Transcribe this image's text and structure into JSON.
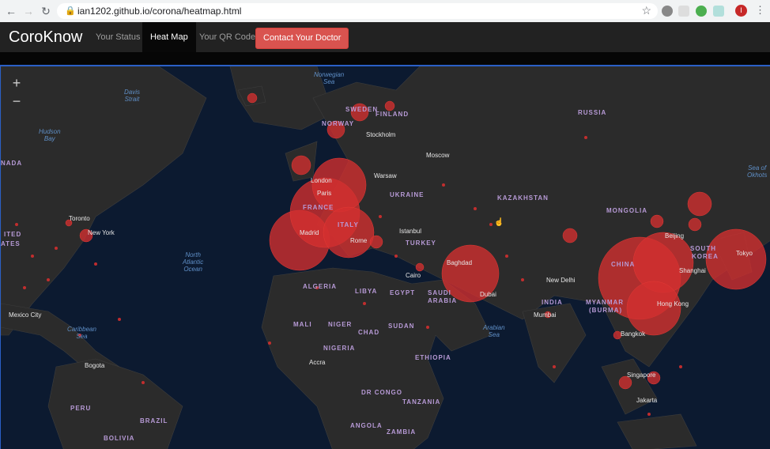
{
  "browser": {
    "url": "ian1202.github.io/corona/heatmap.html",
    "profile_initial": "I"
  },
  "navbar": {
    "brand": "CoroKnow",
    "items": [
      "Your Status",
      "Heat Map",
      "Your QR Code"
    ],
    "cta": "Contact Your Doctor"
  },
  "map": {
    "zoom_in": "+",
    "zoom_out": "−",
    "countries": [
      "RUSSIA",
      "KAZAKHSTAN",
      "MONGOLIA",
      "CHINA",
      "INDIA",
      "UKRAINE",
      "TURKEY",
      "ALGERIA",
      "LIBYA",
      "EGYPT",
      "SAUDI ARABIA",
      "MALI",
      "NIGER",
      "CHAD",
      "SUDAN",
      "NIGERIA",
      "ETHIOPIA",
      "DR CONGO",
      "TANZANIA",
      "ANGOLA",
      "ZAMBIA",
      "BRAZIL",
      "PERU",
      "BOLIVIA",
      "FRANCE",
      "ITALY",
      "SWEDEN",
      "NORWAY",
      "FINLAND",
      "NADA",
      "ITED",
      "ATES",
      "MYANMAR",
      "(BURMA)",
      "SOUTH",
      "KOREA"
    ],
    "oceans": [
      "Norwegian\nSea",
      "Davis\nStrait",
      "Hudson\nBay",
      "North\nAtlantic\nOcean",
      "Caribbean\nSea",
      "Arabian\nSea",
      "Sea of\nOkhots"
    ],
    "cities": [
      "Toronto",
      "New York",
      "Mexico City",
      "Bogota",
      "Accra",
      "Stockholm",
      "Moscow",
      "Warsaw",
      "London",
      "Paris",
      "Madrid",
      "Rome",
      "Istanbul",
      "Cairo",
      "Baghdad",
      "Dubai",
      "New Delhi",
      "Mumbai",
      "Beijing",
      "Shanghai",
      "Tokyo",
      "Hong Kong",
      "Bangkok",
      "Singapore",
      "Jakarta"
    ],
    "bubble_color": "#d32f2f"
  }
}
